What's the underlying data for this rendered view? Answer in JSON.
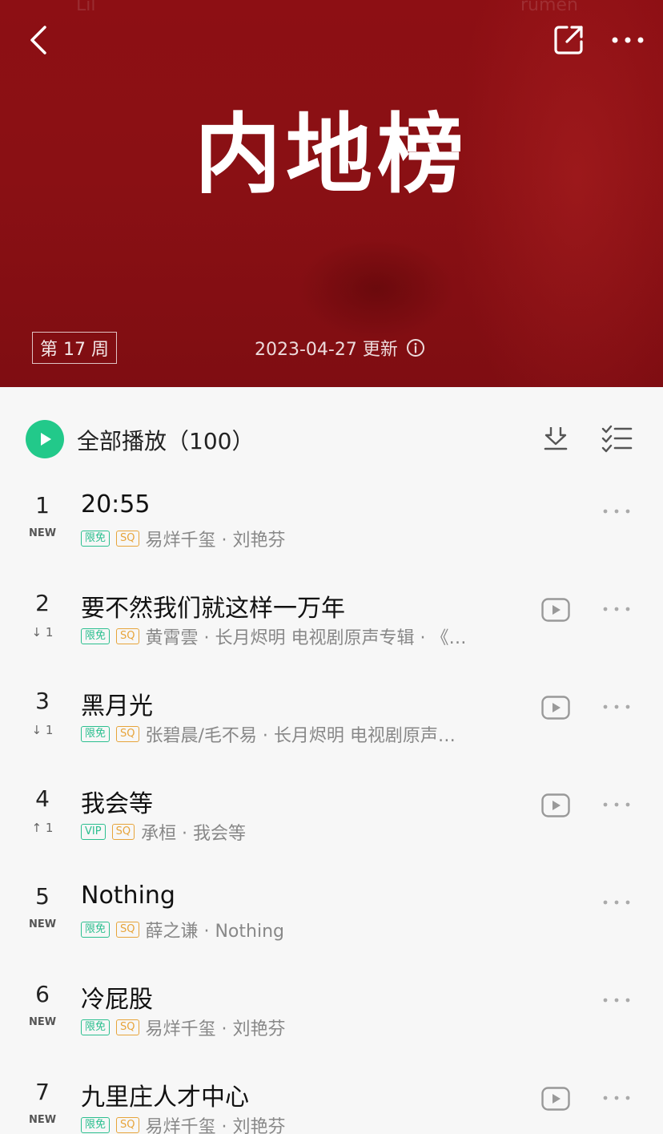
{
  "header": {
    "banner_title": "内地榜",
    "week_badge": "第 17 周",
    "update_text": "2023-04-27 更新",
    "faint_top_left": "Lil",
    "faint_top_right": "rumen"
  },
  "toolbar": {
    "play_all_label": "全部播放（100）"
  },
  "colors": {
    "banner": "#8d0f14",
    "accent_green": "#22c98a",
    "tag_green": "#2bbf8f",
    "tag_gold": "#e7a43a"
  },
  "songs": [
    {
      "rank": "1",
      "trend": "NEW",
      "title": "20:55",
      "tag1": "限免",
      "tag2": "SQ",
      "meta": "易烊千玺 · 刘艳芬",
      "has_mv": false
    },
    {
      "rank": "2",
      "trend": "↓ 1",
      "title": "要不然我们就这样一万年",
      "tag1": "限免",
      "tag2": "SQ",
      "meta": "黄霄雲 · 长月烬明 电视剧原声专辑 · 《…",
      "has_mv": true
    },
    {
      "rank": "3",
      "trend": "↓ 1",
      "title": "黑月光",
      "tag1": "限免",
      "tag2": "SQ",
      "meta": "张碧晨/毛不易 · 长月烬明 电视剧原声…",
      "has_mv": true
    },
    {
      "rank": "4",
      "trend": "↑ 1",
      "title": "我会等",
      "tag1": "VIP",
      "tag2": "SQ",
      "meta": "承桓 · 我会等",
      "has_mv": true
    },
    {
      "rank": "5",
      "trend": "NEW",
      "title": "Nothing",
      "tag1": "限免",
      "tag2": "SQ",
      "meta": "薛之谦 · Nothing",
      "has_mv": false
    },
    {
      "rank": "6",
      "trend": "NEW",
      "title": "冷屁股",
      "tag1": "限免",
      "tag2": "SQ",
      "meta": "易烊千玺 · 刘艳芬",
      "has_mv": false
    },
    {
      "rank": "7",
      "trend": "NEW",
      "title": "九里庄人才中心",
      "tag1": "限免",
      "tag2": "SQ",
      "meta": "易烊千玺 · 刘艳芬",
      "has_mv": true
    }
  ],
  "icons": {
    "back": "back-icon",
    "share": "share-icon",
    "more": "more-icon",
    "info": "info-icon",
    "play": "play-icon",
    "download": "download-icon",
    "multiselect": "multiselect-icon",
    "mv": "mv-icon"
  }
}
